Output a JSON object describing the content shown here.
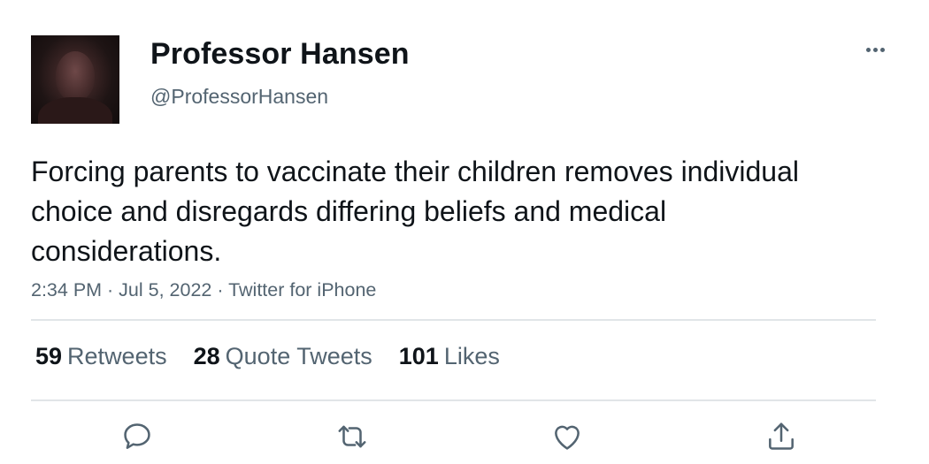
{
  "user": {
    "display_name": "Professor Hansen",
    "handle": "@ProfessorHansen"
  },
  "tweet": {
    "text": "Forcing parents to vaccinate their children removes individual choice and disregards differing beliefs and medical considerations.",
    "meta": "2:34 PM · Jul 5, 2022 · Twitter for iPhone"
  },
  "stats": [
    {
      "count": "59",
      "label": "Retweets"
    },
    {
      "count": "28",
      "label": "Quote Tweets"
    },
    {
      "count": "101",
      "label": "Likes"
    }
  ],
  "actions": {
    "reply_icon": "reply-icon",
    "retweet_icon": "retweet-icon",
    "like_icon": "heart-icon",
    "share_icon": "share-icon"
  },
  "colors": {
    "primary_text": "#0f1419",
    "secondary_text": "#536471",
    "divider": "#e1e5e8"
  }
}
